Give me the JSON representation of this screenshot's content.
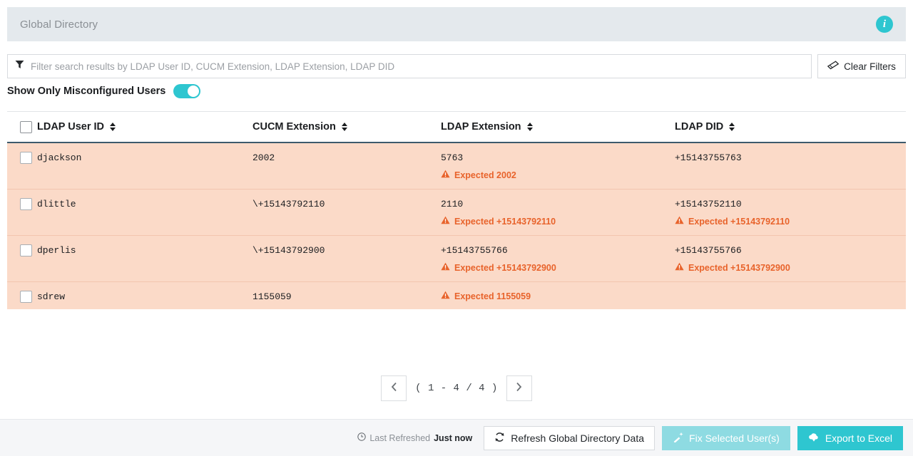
{
  "header": {
    "title": "Global Directory",
    "info_icon": "info-icon"
  },
  "filters": {
    "search_placeholder": "Filter search results by LDAP User ID, CUCM Extension, LDAP Extension, LDAP DID",
    "search_value": "",
    "filter_icon": "funnel-icon",
    "clear_label": "Clear Filters",
    "clear_icon": "eraser-icon",
    "toggle_label": "Show Only Misconfigured Users",
    "toggle_on": "on"
  },
  "table": {
    "columns": [
      {
        "label": "LDAP User ID",
        "sortable": "true"
      },
      {
        "label": "CUCM Extension",
        "sortable": "true"
      },
      {
        "label": "LDAP Extension",
        "sortable": "true"
      },
      {
        "label": "LDAP DID",
        "sortable": "true"
      }
    ],
    "rows": [
      {
        "user": "djackson",
        "cucm": "2002",
        "ext": "5763",
        "ext_warn": "Expected 2002",
        "did": "+15143755763",
        "did_warn": ""
      },
      {
        "user": "dlittle",
        "cucm": "\\+15143792110",
        "ext": "2110",
        "ext_warn": "Expected +15143792110",
        "did": "+15143752110",
        "did_warn": "Expected +15143792110"
      },
      {
        "user": "dperlis",
        "cucm": "\\+15143792900",
        "ext": "+15143755766",
        "ext_warn": "Expected +15143792900",
        "did": "+15143755766",
        "did_warn": "Expected +15143792900"
      },
      {
        "user": "sdrew",
        "cucm": "1155059",
        "ext": "",
        "ext_warn": "Expected 1155059",
        "did": "",
        "did_warn": ""
      }
    ]
  },
  "pagination": {
    "prev_icon": "chevron-left-icon",
    "next_icon": "chevron-right-icon",
    "range_text": "( 1 - 4 / 4 )"
  },
  "footer": {
    "refreshed_label": "Last Refreshed",
    "refreshed_value": "Just now",
    "clock_icon": "clock-icon",
    "refresh_label": "Refresh Global Directory Data",
    "refresh_icon": "refresh-icon",
    "fix_label": "Fix Selected User(s)",
    "fix_icon": "magic-wand-icon",
    "export_label": "Export to Excel",
    "export_icon": "cloud-download-icon"
  },
  "colors": {
    "accent_teal": "#2EC6D0",
    "warning_orange": "#E8632B",
    "row_bg": "#FBDAC8",
    "header_bar": "#E4E9ED",
    "footer_bg": "#F5F6F8"
  }
}
